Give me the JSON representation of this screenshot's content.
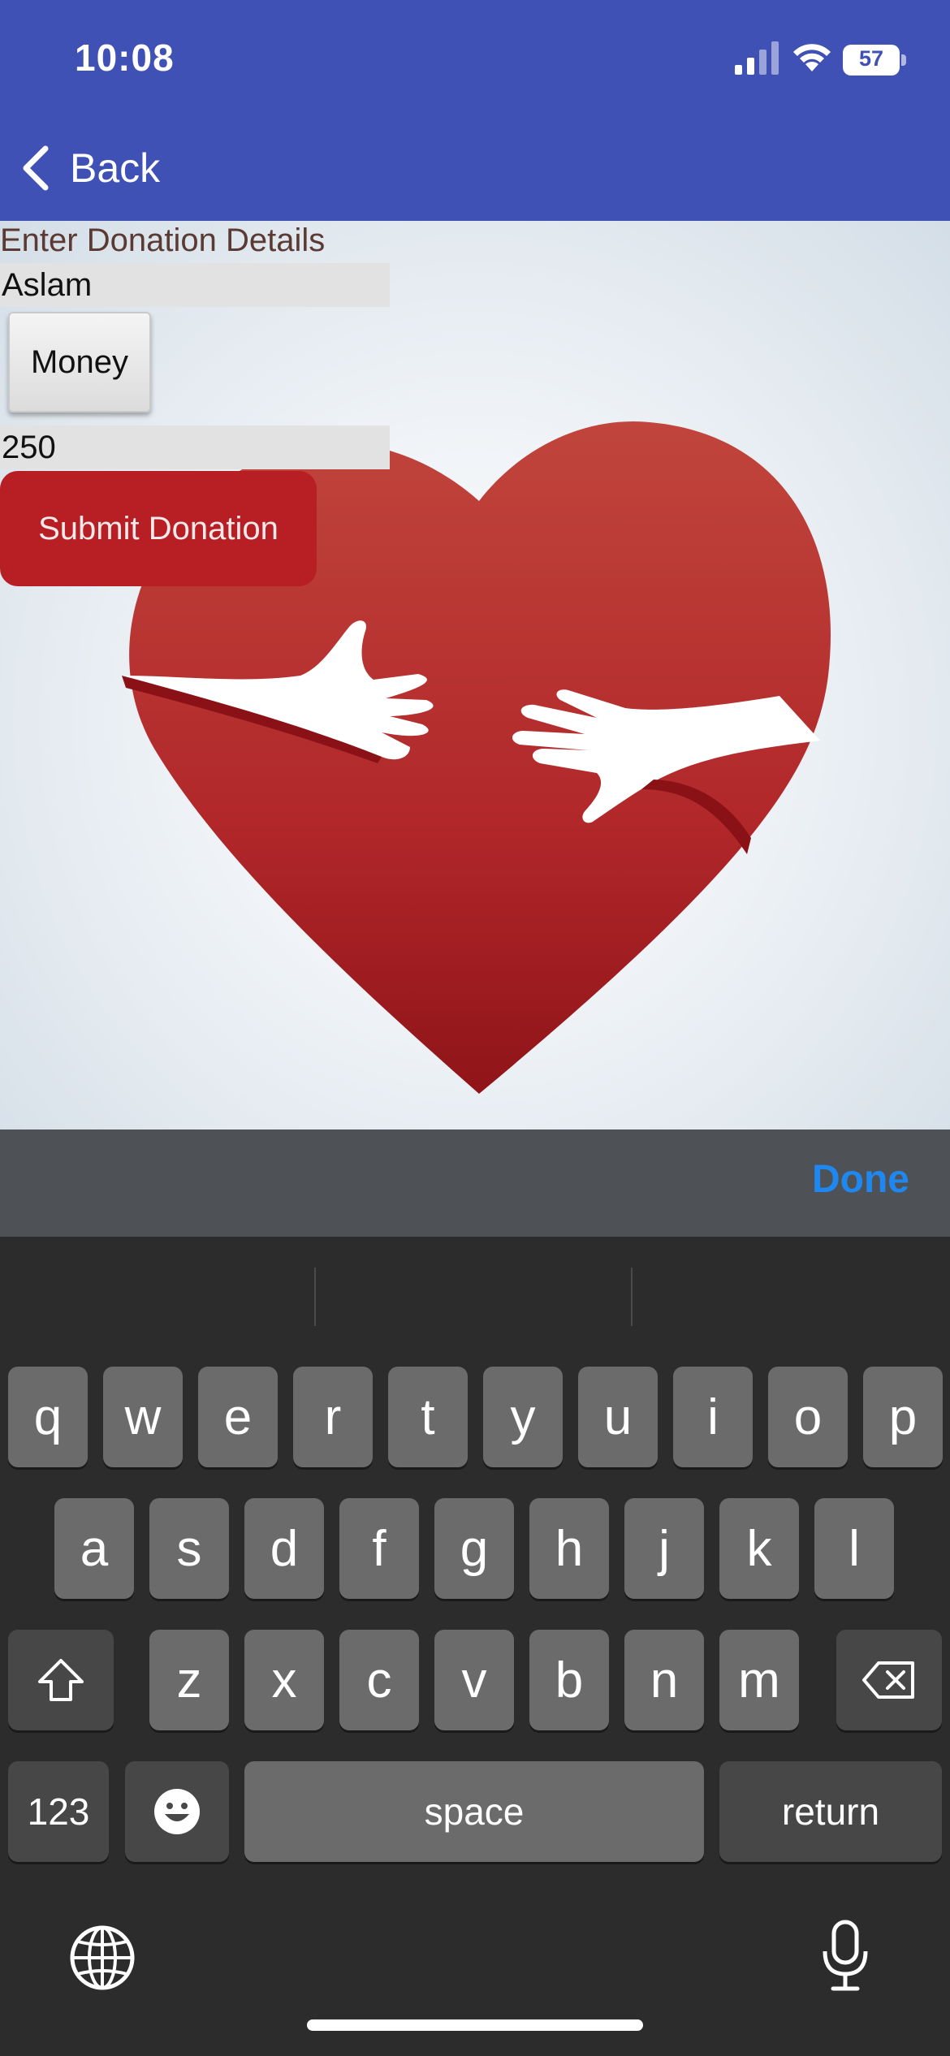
{
  "status_bar": {
    "time": "10:08",
    "battery": "57"
  },
  "nav": {
    "back_label": "Back"
  },
  "form": {
    "title": "Enter Donation Details",
    "name_value": "Aslam",
    "type_button": "Money",
    "amount_value": "250",
    "submit_label": "Submit Donation"
  },
  "accessory": {
    "done_label": "Done"
  },
  "keyboard": {
    "row1": [
      "q",
      "w",
      "e",
      "r",
      "t",
      "y",
      "u",
      "i",
      "o",
      "p"
    ],
    "row2": [
      "a",
      "s",
      "d",
      "f",
      "g",
      "h",
      "j",
      "k",
      "l"
    ],
    "row3": [
      "z",
      "x",
      "c",
      "v",
      "b",
      "n",
      "m"
    ],
    "numbers_key": "123",
    "space_key": "space",
    "return_key": "return"
  },
  "colors": {
    "nav_bar": "#3f51b5",
    "submit": "#b71f24",
    "done": "#1e88f0",
    "heart": "#b5272c"
  }
}
